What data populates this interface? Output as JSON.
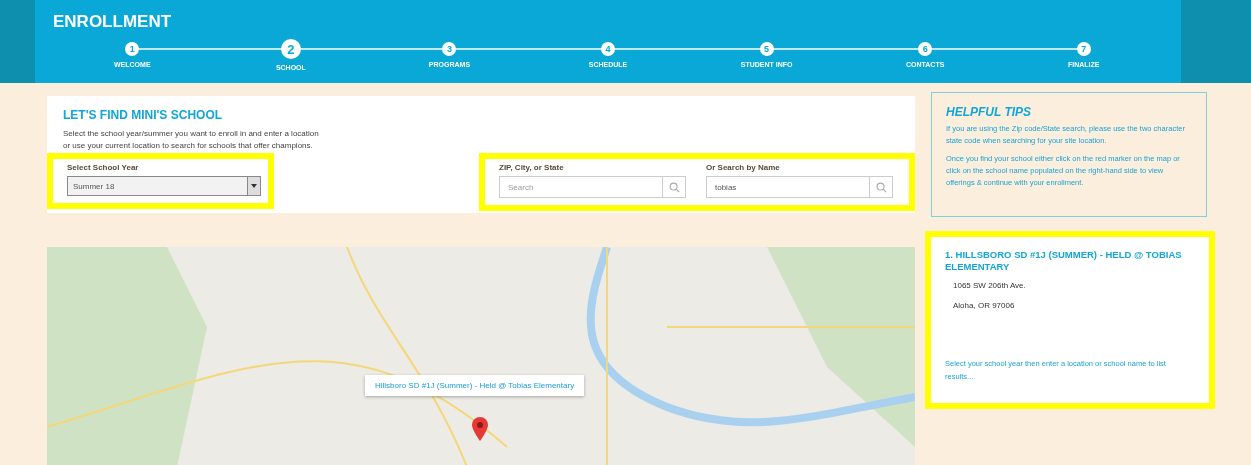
{
  "header": {
    "title": "ENROLLMENT"
  },
  "steps": [
    {
      "number": "1",
      "label": "WELCOME",
      "selected": false
    },
    {
      "number": "2",
      "label": "SCHOOL",
      "selected": true
    },
    {
      "number": "3",
      "label": "PROGRAMS",
      "selected": false
    },
    {
      "number": "4",
      "label": "SCHEDULE",
      "selected": false
    },
    {
      "number": "5",
      "label": "STUDENT INFO",
      "selected": false
    },
    {
      "number": "6",
      "label": "CONTACTS",
      "selected": false
    },
    {
      "number": "7",
      "label": "FINALIZE",
      "selected": false
    }
  ],
  "search_card": {
    "heading": "LET'S FIND MINI'S SCHOOL",
    "intro_lines": [
      "Select the school year/summer you want to enroll in and enter a location",
      "or use your current location to search for schools that offer champions."
    ],
    "school_year": {
      "label": "Select School Year",
      "value": "Summer 18"
    },
    "location": {
      "label": "ZIP, City, or State",
      "placeholder": "Search"
    },
    "name_search": {
      "label": "Or Search by Name",
      "value": "tobias"
    }
  },
  "map": {
    "popup": "Hillsboro SD #1J (Summer) - Held @ Tobias Elementary"
  },
  "tips": {
    "heading": "HELPFUL TIPS",
    "paragraphs": [
      "If you are using the Zip code/State search, please use the two character state code when searching for your site location.",
      "Once you find your school either click on the red marker on the map or click on the school name populated on the right-hand side to view offerings & continue with your enrollment."
    ]
  },
  "results": {
    "items": [
      {
        "title": "1. HILLSBORO SD #1J (SUMMER) - HELD @ TOBIAS ELEMENTARY",
        "address_lines": [
          "1065 SW 206th Ave.",
          "Aloha, OR 97006"
        ]
      }
    ],
    "hint": "Select your school year then enter a location or school name to list results..."
  }
}
